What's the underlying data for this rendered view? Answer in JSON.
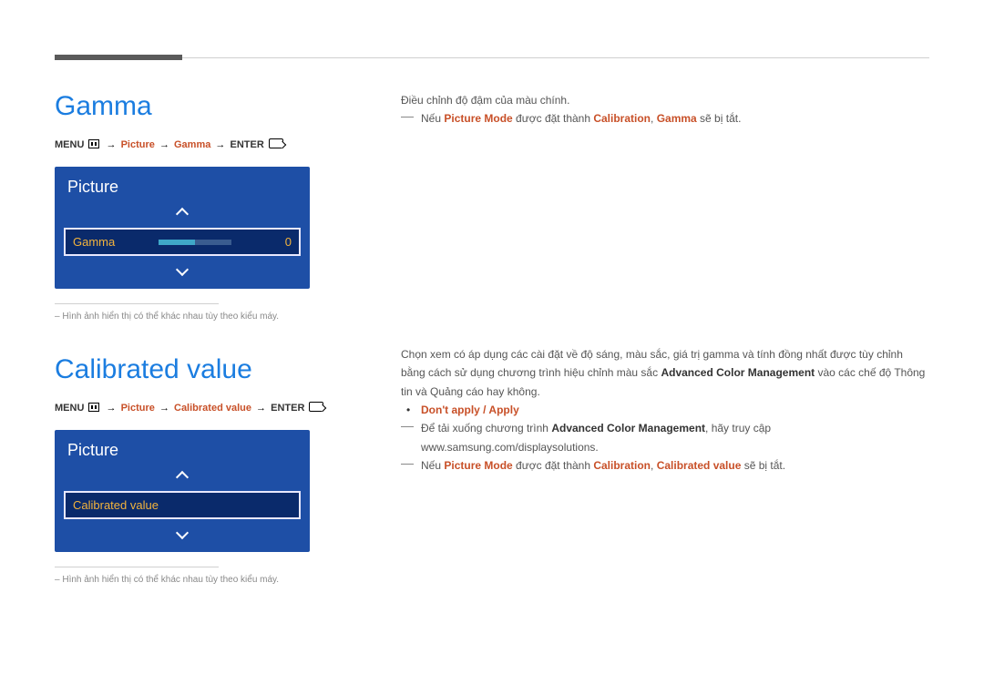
{
  "gamma": {
    "title": "Gamma",
    "nav": {
      "menu": "MENU",
      "path1": "Picture",
      "path2": "Gamma",
      "enter": "ENTER"
    },
    "panel": {
      "header": "Picture",
      "selected": "Gamma",
      "value": "0"
    },
    "note": "Hình ảnh hiển thị có thể khác nhau tùy theo kiểu máy.",
    "right": {
      "line1": "Điều chỉnh độ đậm của màu chính.",
      "line2_pre": "Nếu ",
      "line2_pm": "Picture Mode",
      "line2_mid": " được đặt thành ",
      "line2_cal": "Calibration",
      "line2_sep": ", ",
      "line2_g": "Gamma",
      "line2_post": " sẽ bị tắt."
    }
  },
  "cal": {
    "title": "Calibrated value",
    "nav": {
      "menu": "MENU",
      "path1": "Picture",
      "path2": "Calibrated value",
      "enter": "ENTER"
    },
    "panel": {
      "header": "Picture",
      "selected": "Calibrated value"
    },
    "note": "Hình ảnh hiển thị có thể khác nhau tùy theo kiểu máy.",
    "right": {
      "p1_a": "Chọn xem có áp dụng các cài đặt về độ sáng, màu sắc, giá trị gamma và tính đồng nhất được tùy chỉnh bằng cách sử dụng chương trình hiệu chỉnh màu sắc ",
      "p1_b": "Advanced Color Management",
      "p1_c": " vào các chế độ Thông tin và Quảng cáo hay không.",
      "opt": "Don't apply / Apply",
      "p2_a": "Để tải xuống chương trình ",
      "p2_b": "Advanced Color Management",
      "p2_c": ", hãy truy cập www.samsung.com/displaysolutions.",
      "p3_pre": "Nếu ",
      "p3_pm": "Picture Mode",
      "p3_mid": " được đặt thành ",
      "p3_cal": "Calibration",
      "p3_sep": ", ",
      "p3_cv": "Calibrated value",
      "p3_post": " sẽ bị tắt."
    }
  }
}
